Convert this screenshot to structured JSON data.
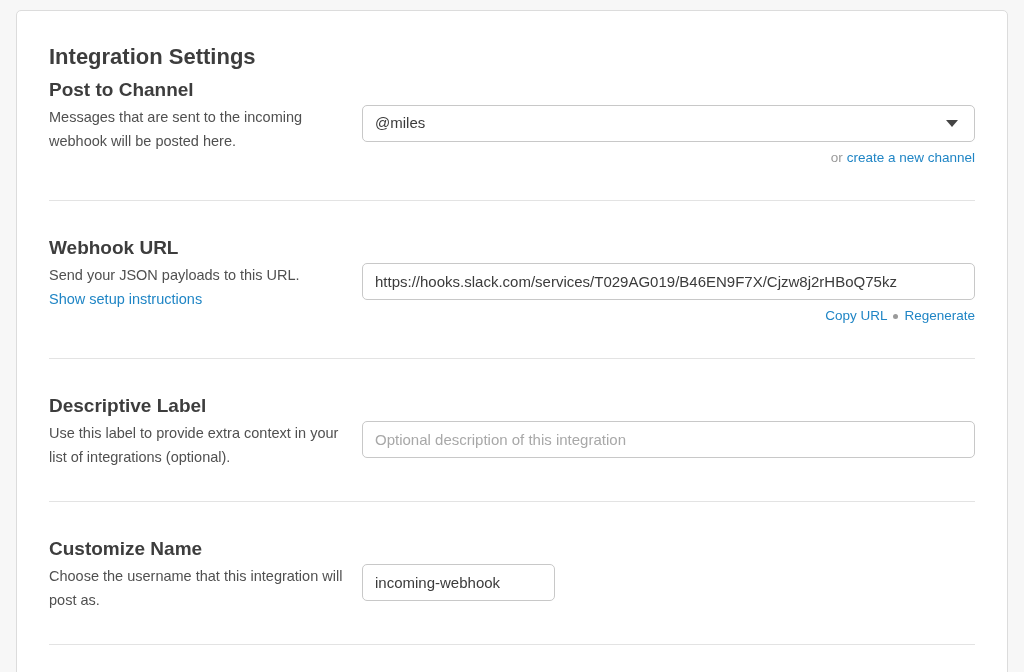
{
  "page_title": "Integration Settings",
  "sections": [
    {
      "kind": "select",
      "title": "Post to Channel",
      "description": "Messages that are sent to the incoming webhook will be posted here.",
      "value": "@miles",
      "note": "or",
      "links": [
        "create a new channel"
      ]
    },
    {
      "kind": "url",
      "title": "Webhook URL",
      "description": "Send your JSON payloads to this URL.",
      "description_link": "Show setup instructions",
      "value": "https://hooks.slack.com/services/T029AG019/B46EN9F7X/Cjzw8j2rHBoQ75kz",
      "links": [
        "Copy URL",
        "Regenerate"
      ]
    },
    {
      "kind": "text",
      "title": "Descriptive Label",
      "description": "Use this label to provide extra context in your list of integrations (optional).",
      "placeholder": "Optional description of this integration"
    },
    {
      "kind": "short",
      "title": "Customize Name",
      "description": "Choose the username that this integration will post as.",
      "value": "incoming-webhook"
    }
  ]
}
